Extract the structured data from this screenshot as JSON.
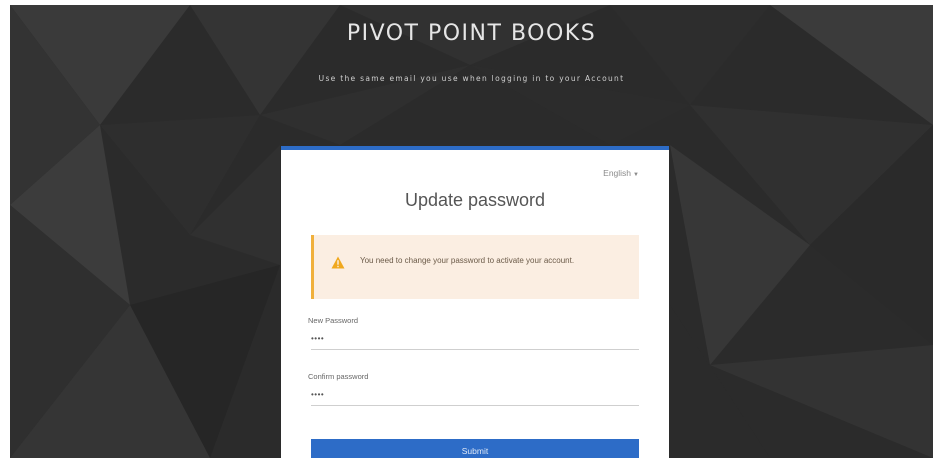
{
  "header": {
    "brand": "PIVOT POINT BOOKS",
    "subtitle": "Use the same email you use when logging in to your Account"
  },
  "card": {
    "language": "English",
    "title": "Update password",
    "alert": {
      "icon": "warning-icon",
      "message": "You need to change your password to activate your account."
    },
    "new_password": {
      "label": "New Password",
      "value": "••••"
    },
    "confirm_password": {
      "label": "Confirm password",
      "value": "••••"
    },
    "submit_label": "Submit"
  },
  "colors": {
    "accent": "#2d6cc7",
    "alert_bg": "#fbeee2",
    "alert_border": "#f0b03c",
    "background": "#2a2a2a"
  }
}
